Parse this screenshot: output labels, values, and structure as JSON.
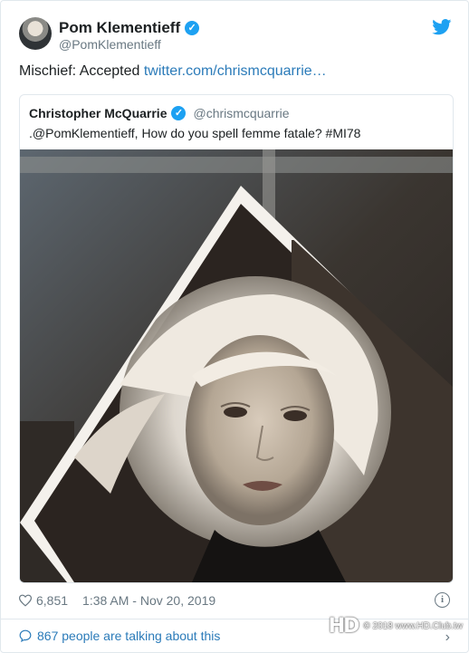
{
  "author": {
    "display_name": "Pom Klementieff",
    "handle": "@PomKlementieff",
    "verified": true
  },
  "tweet": {
    "text_prefix": "Mischief: Accepted ",
    "link_text": "twitter.com/chrismcquarrie…"
  },
  "quoted_tweet": {
    "display_name": "Christopher McQuarrie",
    "handle": "@chrismcquarrie",
    "verified": true,
    "text": ".@PomKlementieff, How do you spell femme fatale? #MI78"
  },
  "meta": {
    "likes": "6,851",
    "timestamp": "1:38 AM - Nov 20, 2019"
  },
  "footer": {
    "talking": "867 people are talking about this"
  },
  "watermark": {
    "logo": "HD",
    "text": "© 2018 www.HD.Club.tw"
  },
  "colors": {
    "brand_blue": "#1da1f2",
    "link": "#2b7bb9",
    "muted": "#697882",
    "border": "#e1e8ed"
  },
  "icons": [
    "twitter-bird-icon",
    "verified-icon",
    "heart-icon",
    "info-icon",
    "speech-bubble-icon",
    "chevron-right-icon"
  ]
}
